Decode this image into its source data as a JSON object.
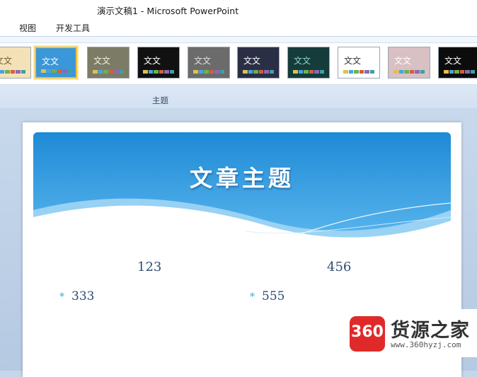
{
  "window": {
    "title": "演示文稿1 - Microsoft PowerPoint"
  },
  "menu": [
    {
      "label": "视图"
    },
    {
      "label": "开发工具"
    }
  ],
  "themes": {
    "group_label": "主题",
    "thumbnail_text": "文文",
    "items": [
      {
        "name": "theme-1",
        "bg": "#f3e2b8",
        "fg": "#7a5a30"
      },
      {
        "name": "theme-2",
        "bg": "#3a97d9",
        "fg": "#ffffff",
        "selected": true
      },
      {
        "name": "theme-3",
        "bg": "#7c7c66",
        "fg": "#f0f0e0"
      },
      {
        "name": "theme-4",
        "bg": "#111111",
        "fg": "#ffffff"
      },
      {
        "name": "theme-5",
        "bg": "#6b6b6b",
        "fg": "#e0e0e0"
      },
      {
        "name": "theme-6",
        "bg": "#2b2f45",
        "fg": "#ffffff"
      },
      {
        "name": "theme-7",
        "bg": "#153c3a",
        "fg": "#8fd4c4"
      },
      {
        "name": "theme-8",
        "bg": "#ffffff",
        "fg": "#333333"
      },
      {
        "name": "theme-9",
        "bg": "#d9c0c4",
        "fg": "#ffffff"
      },
      {
        "name": "theme-10",
        "bg": "#0c0c0c",
        "fg": "#ffffff"
      }
    ]
  },
  "slide": {
    "title": "文章主题",
    "left_header": "123",
    "right_header": "456",
    "left_bullet": "333",
    "right_bullet": "555",
    "bullet_symbol": "*",
    "accent": "#2c92d8"
  },
  "watermark": {
    "logo_text": "360",
    "name": "货源之家",
    "url": "www.360hyzj.com"
  }
}
